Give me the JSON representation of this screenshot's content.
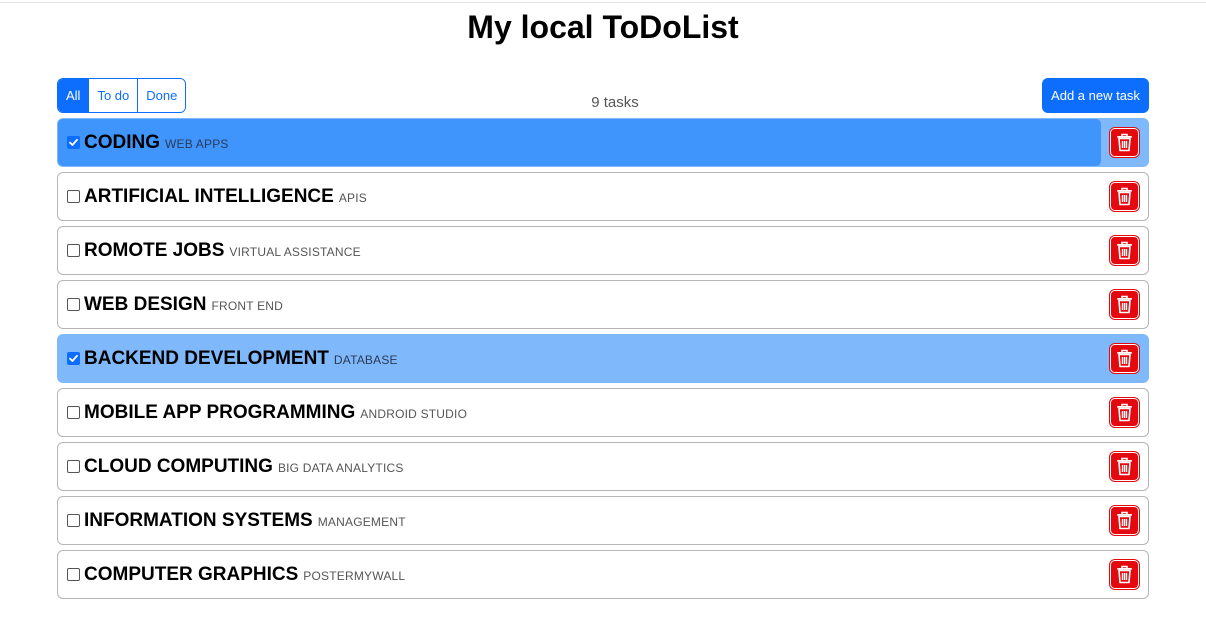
{
  "page_title": "My local ToDoList",
  "filters": [
    {
      "label": "All",
      "active": true
    },
    {
      "label": "To do",
      "active": false
    },
    {
      "label": "Done",
      "active": false
    }
  ],
  "task_count": "9 tasks",
  "add_button": "Add a new task",
  "tasks": [
    {
      "name": "CODING",
      "category": "WEB APPS",
      "done": true,
      "highlighted": true
    },
    {
      "name": "ARTIFICIAL INTELLIGENCE",
      "category": "APIS",
      "done": false
    },
    {
      "name": "ROMOTE JOBS",
      "category": "VIRTUAL ASSISTANCE",
      "done": false
    },
    {
      "name": "WEB DESIGN",
      "category": "FRONT END",
      "done": false
    },
    {
      "name": "BACKEND DEVELOPMENT",
      "category": "DATABASE",
      "done": true
    },
    {
      "name": "MOBILE APP PROGRAMMING",
      "category": "ANDROID STUDIO",
      "done": false
    },
    {
      "name": "CLOUD COMPUTING",
      "category": "BIG DATA ANALYTICS",
      "done": false
    },
    {
      "name": "INFORMATION SYSTEMS",
      "category": "MANAGEMENT",
      "done": false
    },
    {
      "name": "COMPUTER GRAPHICS",
      "category": "POSTERMYWALL",
      "done": false
    }
  ],
  "icons": {
    "checkbox": "check-icon",
    "delete": "trash-icon"
  },
  "colors": {
    "primary": "#0d6efd",
    "done_row": "#7fb8fb",
    "active_row": "#3f95fc",
    "delete": "#e4090e"
  }
}
